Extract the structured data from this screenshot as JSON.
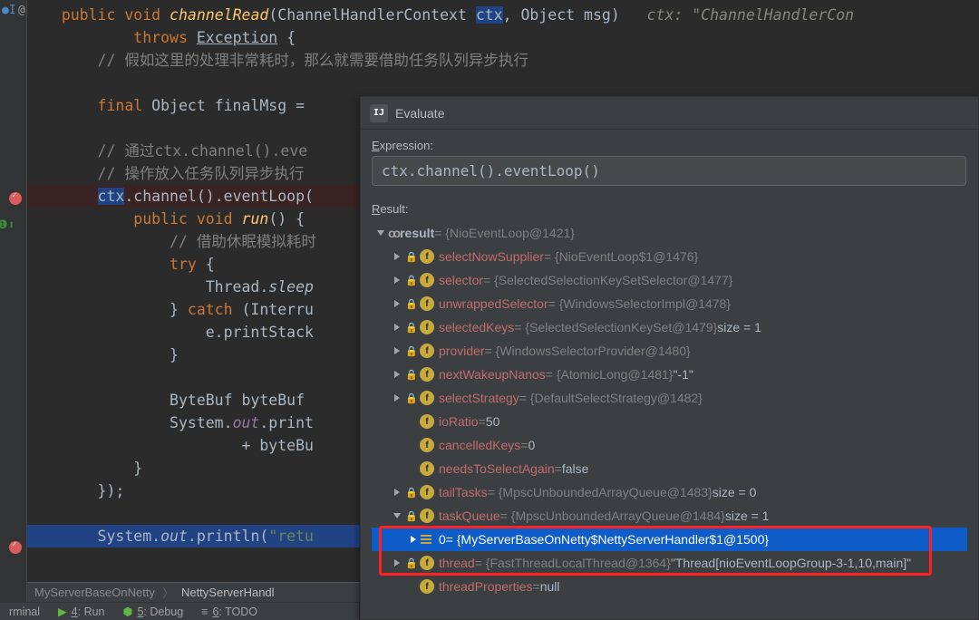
{
  "code": {
    "l1a": "public",
    "l1b": "void",
    "l1c": "channelRead",
    "l1d": "(ChannelHandlerContext ",
    "l1e": "ctx",
    "l1f": ", Object msg)",
    "l1g": "ctx: \"ChannelHandlerCon",
    "l2a": "throws",
    "l2b": "Exception",
    "l2c": "{",
    "l3": "// 假如这里的处理非常耗时，那么就需要借助任务队列异步执行",
    "l5a": "final",
    "l5b": "Object finalMsg = ",
    "l7": "// 通过ctx.channel().eve",
    "l8": "// 操作放入任务队列异步执行",
    "l9a": "ctx",
    "l9b": ".channel().eventLoop(",
    "l10a": "public",
    "l10b": "void",
    "l10c": "run",
    "l10d": "() {",
    "l11": "// 借助休眠模拟耗时",
    "l12a": "try",
    "l12b": "{",
    "l13a": "Thread.",
    "l13b": "sleep",
    "l14a": "} ",
    "l14b": "catch",
    "l14c": "(Interru",
    "l15": "e.printStack",
    "l16": "}",
    "l18": "ByteBuf byteBuf ",
    "l19a": "System.",
    "l19b": "out",
    "l19c": ".print",
    "l20": "+ byteBu",
    "l21": "}",
    "l22": "});",
    "l24a": "System.",
    "l24b": "out",
    "l24c": ".println(",
    "l24d": "\"retu"
  },
  "eval": {
    "title": "Evaluate",
    "expr_label_u": "E",
    "expr_label_rest": "xpression:",
    "input_value": "ctx.channel().eventLoop()",
    "result_label_u": "R",
    "result_label_rest": "esult:",
    "rows": {
      "r0_name": "result",
      "r0_val": " = {NioEventLoop@1421}",
      "r1_name": "selectNowSupplier",
      "r1_val": " = {NioEventLoop$1@1476}",
      "r2_name": "selector",
      "r2_val": " = {SelectedSelectionKeySetSelector@1477}",
      "r3_name": "unwrappedSelector",
      "r3_val": " = {WindowsSelectorImpl@1478}",
      "r4_name": "selectedKeys",
      "r4_val": " = {SelectedSelectionKeySet@1479} ",
      "r4_extra": " size = 1",
      "r5_name": "provider",
      "r5_val": " = {WindowsSelectorProvider@1480}",
      "r6_name": "nextWakeupNanos",
      "r6_val": " = {AtomicLong@1481} ",
      "r6_extra": "\"-1\"",
      "r7_name": "selectStrategy",
      "r7_val": " = {DefaultSelectStrategy@1482}",
      "r8_name": "ioRatio",
      "r8_val": " = ",
      "r8_num": "50",
      "r9_name": "cancelledKeys",
      "r9_val": " = ",
      "r9_num": "0",
      "r10_name": "needsToSelectAgain",
      "r10_val": " = ",
      "r10_num": "false",
      "r11_name": "tailTasks",
      "r11_val": " = {MpscUnboundedArrayQueue@1483} ",
      "r11_extra": " size = 0",
      "r12_name": "taskQueue",
      "r12_val": " = {MpscUnboundedArrayQueue@1484} ",
      "r12_extra": " size = 1",
      "r13_name": "0",
      "r13_val": " = {MyServerBaseOnNetty$NettyServerHandler$1@1500}",
      "r14_name": "thread",
      "r14_val": " = {FastThreadLocalThread@1364} ",
      "r14_extra": "\"Thread[nioEventLoopGroup-3-1,10,main]\"",
      "r15_name": "threadProperties",
      "r15_val": " = ",
      "r15_num": "null"
    }
  },
  "crumbs": {
    "c1": "MyServerBaseOnNetty",
    "c2": "NettyServerHandl"
  },
  "tool": {
    "t0": "rminal",
    "t1a": "4",
    "t1b": ": Run",
    "t2a": "5",
    "t2b": ": Debug",
    "t3a": "6",
    "t3b": ": TODO"
  }
}
